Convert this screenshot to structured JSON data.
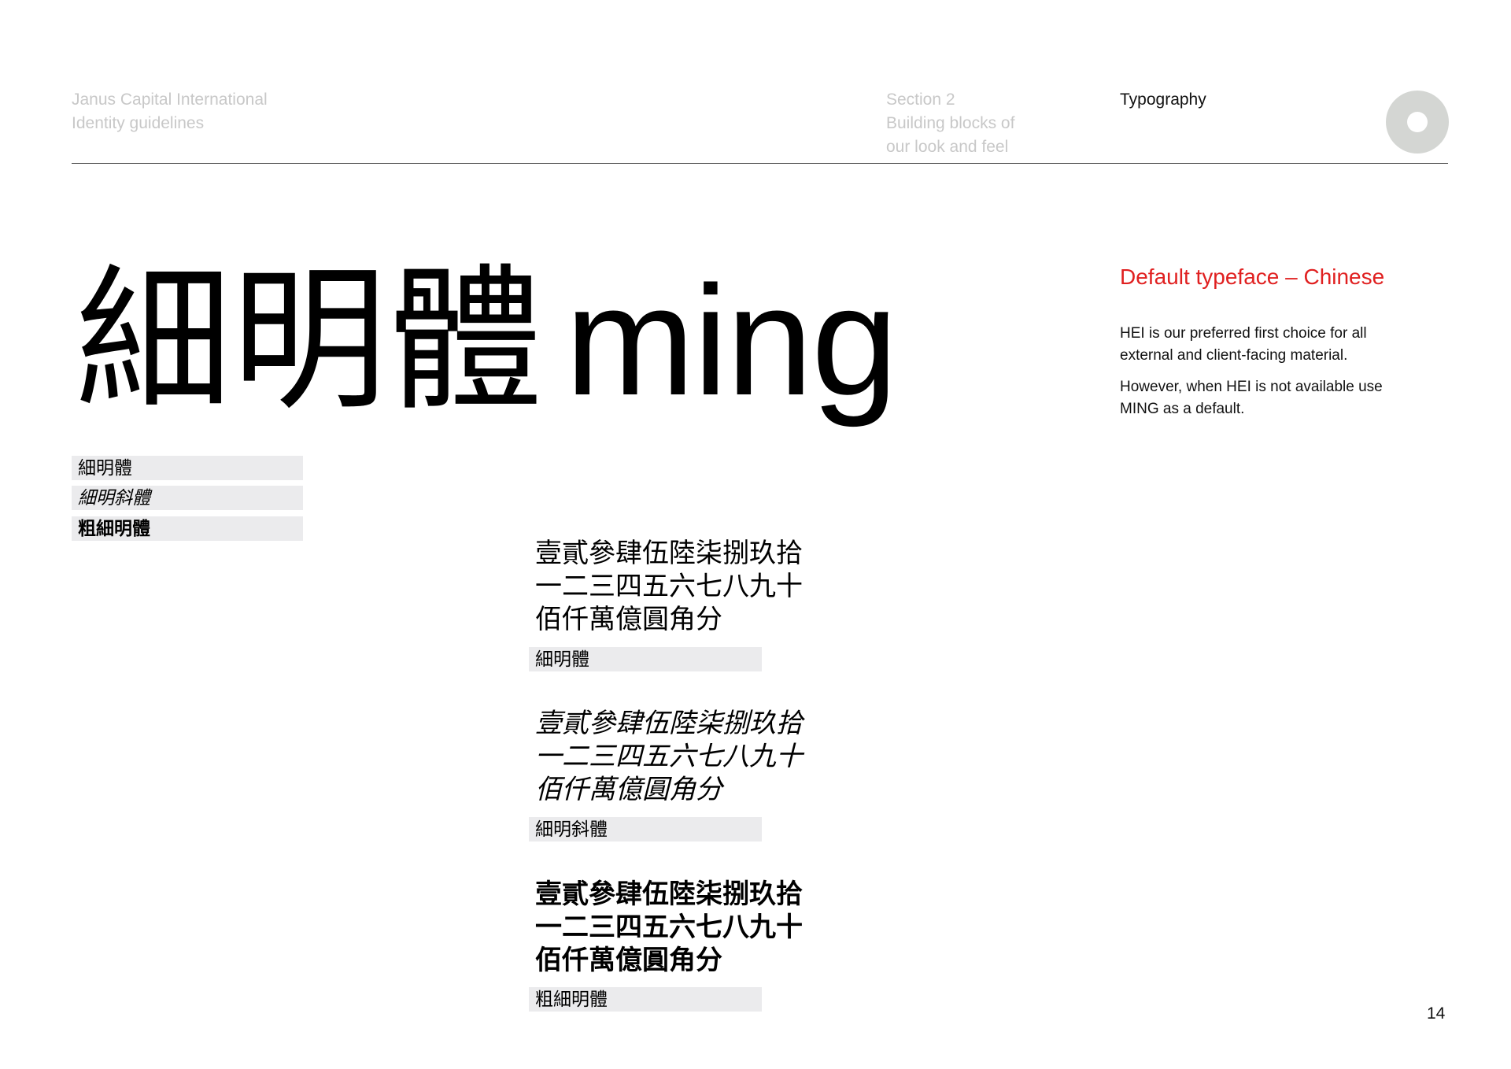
{
  "header": {
    "brand_lines": [
      "Janus Capital International",
      "Identity guidelines"
    ],
    "section_lines": [
      "Section 2",
      "Building blocks of",
      "our look and feel"
    ],
    "topic": "Typography"
  },
  "hero": {
    "cjk": "細明體",
    "latin": "ming"
  },
  "left_tags": [
    "細明體",
    "細明斜體",
    "粗細明體"
  ],
  "samples": [
    {
      "lines": [
        "壹貳參肆伍陸柒捌玖拾",
        "一二三四五六七八九十",
        "佰仟萬億圓角分"
      ],
      "label": "細明體"
    },
    {
      "lines": [
        "壹貳參肆伍陸柒捌玖拾",
        "一二三四五六七八九十",
        "佰仟萬億圓角分"
      ],
      "label": "細明斜體"
    },
    {
      "lines": [
        "壹貳參肆伍陸柒捌玖拾",
        "一二三四五六七八九十",
        "佰仟萬億圓角分"
      ],
      "label": "粗細明體"
    }
  ],
  "sidebar": {
    "title": "Default typeface – Chinese",
    "para1_lines": [
      "HEI is our preferred first choice for all",
      "external and client-facing material."
    ],
    "para2_lines": [
      "However, when HEI is not available use",
      "MING as a default."
    ]
  },
  "page_number": "14",
  "colors": {
    "accent": "#e02020",
    "muted_text": "#c8c8c8",
    "tag_bg": "#ebebed",
    "circle": "#d4d6d3"
  }
}
